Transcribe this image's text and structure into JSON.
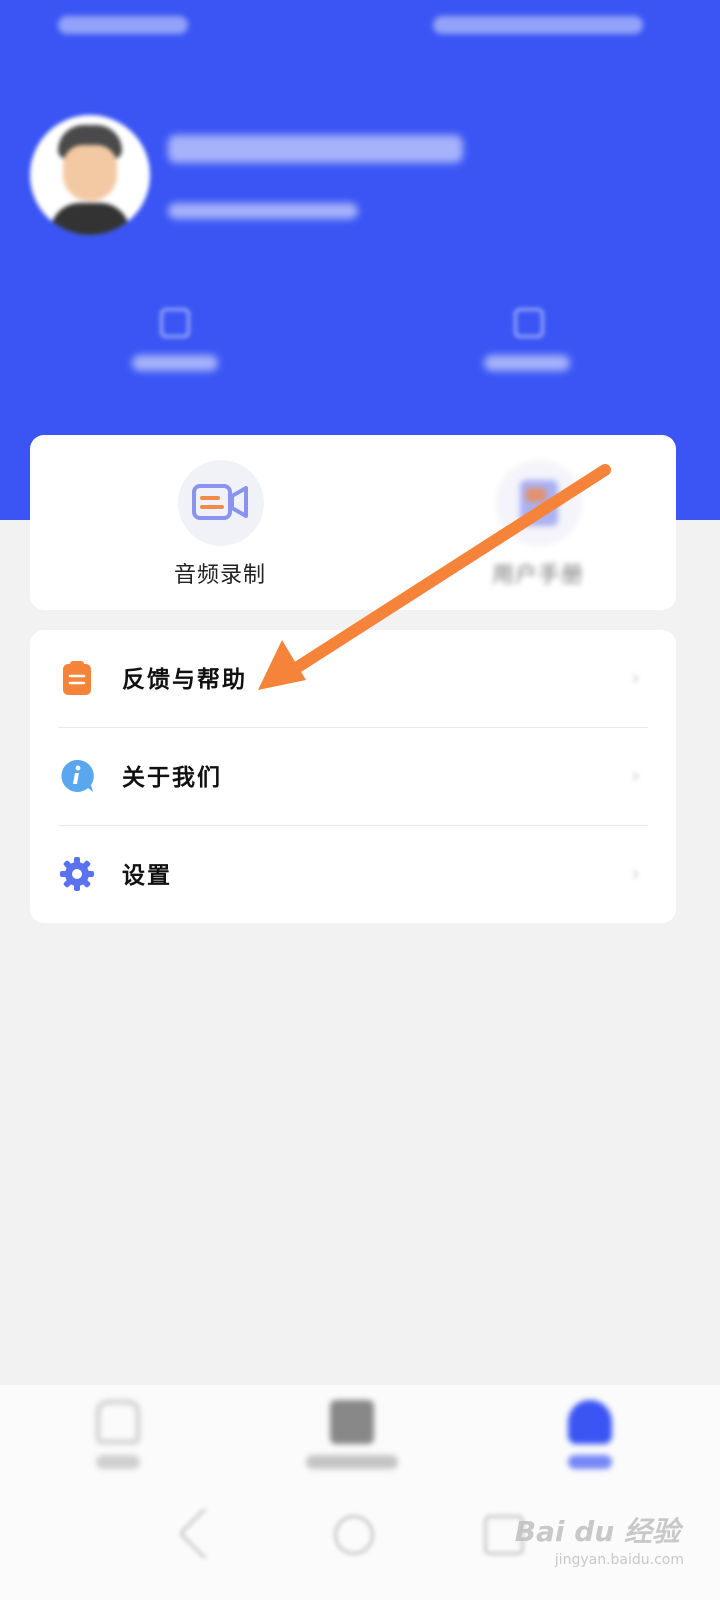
{
  "quick_actions": [
    {
      "label": "音频录制"
    },
    {
      "label": "用户手册"
    }
  ],
  "menu": [
    {
      "label": "反馈与帮助",
      "icon": "clipboard-icon"
    },
    {
      "label": "关于我们",
      "icon": "info-icon"
    },
    {
      "label": "设置",
      "icon": "gear-icon"
    }
  ],
  "watermark": {
    "brand": "Bai du 经验",
    "url": "jingyan.baidu.com"
  },
  "colors": {
    "header": "#3a55f4",
    "accent_orange": "#f5843a",
    "tab_active": "#3a55f4"
  }
}
